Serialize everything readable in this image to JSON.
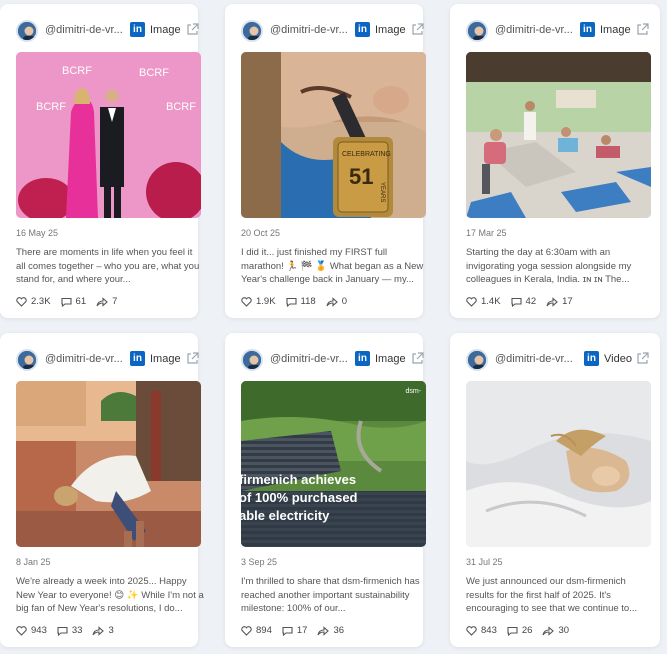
{
  "colors": {
    "linkedin": "#0a66c2",
    "background": "#eef1f5",
    "card": "#ffffff"
  },
  "icons": [
    "linkedin-icon",
    "external-link-icon",
    "heart-icon",
    "comment-icon",
    "share-icon"
  ],
  "posts": [
    {
      "handle": "@dimitri-de-vr...",
      "platform": "in",
      "media_type": "Image",
      "date": "16 May 25",
      "text": "There are moments in life when you feel it all comes together – who you are, what you stand for, and where your...",
      "likes": "2.3K",
      "comments": "61",
      "shares": "7",
      "media_text": {
        "banner": "BCRF"
      }
    },
    {
      "handle": "@dimitri-de-vr...",
      "platform": "in",
      "media_type": "Image",
      "date": "20 Oct 25",
      "text": "I did it... just finished my FIRST full marathon! 🏃 🏁 🏅 What began as a New Year's challenge back in January — my...",
      "likes": "1.9K",
      "comments": "118",
      "shares": "0",
      "media_text": {
        "medal_top": "CELEBRATING",
        "medal_number": "51",
        "medal_side": "YEARS"
      }
    },
    {
      "handle": "@dimitri-de-vr...",
      "platform": "in",
      "media_type": "Image",
      "date": "17 Mar 25",
      "text": "Starting the day at 6:30am with an invigorating yoga session alongside my colleagues in Kerala, India. ɪɴ ɪɴ The...",
      "likes": "1.4K",
      "comments": "42",
      "shares": "17"
    },
    {
      "handle": "@dimitri-de-vr...",
      "platform": "in",
      "media_type": "Image",
      "date": "8 Jan 25",
      "text": "We're already a week into 2025... Happy New Year to everyone! 😊 ✨ While I'm not a big fan of New Year's resolutions, I do...",
      "likes": "943",
      "comments": "33",
      "shares": "3"
    },
    {
      "handle": "@dimitri-de-vr...",
      "platform": "in",
      "media_type": "Image",
      "date": "3 Sep 25",
      "text": "I'm thrilled to share that dsm-firmenich has reached another important sustainability milestone: 100% of our...",
      "likes": "894",
      "comments": "17",
      "shares": "36",
      "media_text": {
        "line1": "firmenich achieves",
        "line2": "of 100% purchased",
        "line3": "able electricity",
        "corner": "dsm-"
      }
    },
    {
      "handle": "@dimitri-de-vr...",
      "platform": "in",
      "media_type": "Video",
      "date": "31 Jul 25",
      "text": "We just announced our dsm-firmenich results for the first half of 2025. It's encouraging to see that we continue to...",
      "likes": "843",
      "comments": "26",
      "shares": "30"
    }
  ]
}
